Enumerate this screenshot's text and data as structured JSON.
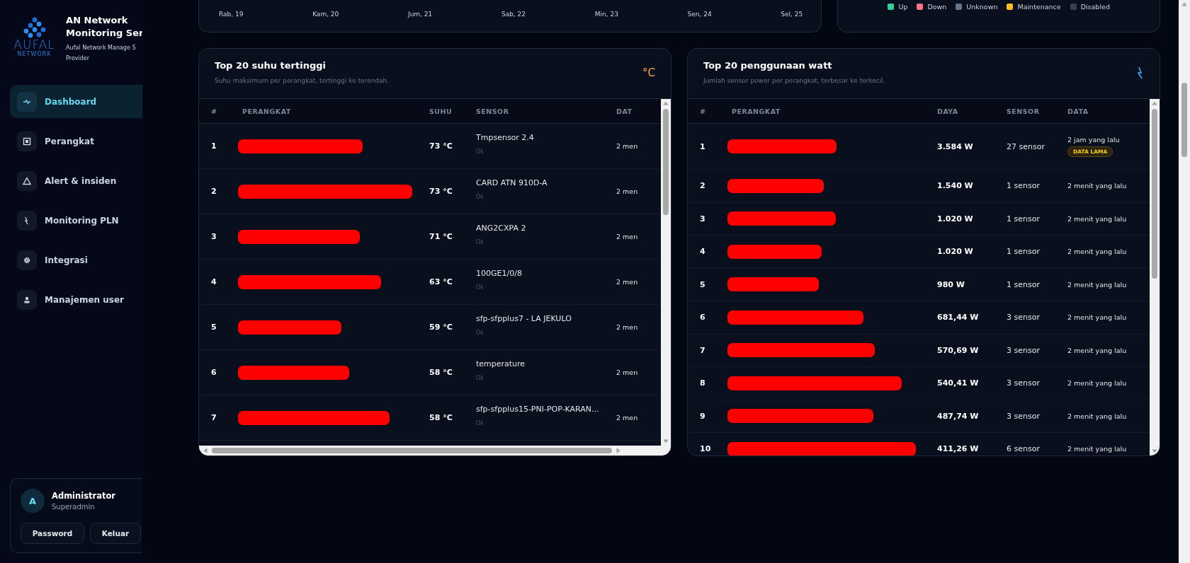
{
  "brand": {
    "logo_top": "AUFAL",
    "logo_bottom": "NETWORK",
    "title_lines": [
      "AN Network",
      "Monitoring Ser"
    ],
    "subtitle_lines": [
      "Aufal Network Manage S",
      "Provider"
    ]
  },
  "nav": [
    {
      "label": "Dashboard",
      "kind": "pulse",
      "selected": true
    },
    {
      "label": "Perangkat",
      "kind": "device",
      "selected": false
    },
    {
      "label": "Alert & insiden",
      "kind": "alert",
      "selected": false
    },
    {
      "label": "Monitoring PLN",
      "kind": "bolt",
      "selected": false
    },
    {
      "label": "Integrasi",
      "kind": "gear",
      "selected": false
    },
    {
      "label": "Manajemen user",
      "kind": "user",
      "selected": false
    }
  ],
  "user": {
    "initial": "A",
    "name": "Administrator",
    "role": "Superadmin",
    "buttons": [
      "Password",
      "Keluar"
    ]
  },
  "timeline": {
    "x_labels": [
      "Rab, 19",
      "Kam, 20",
      "Jum, 21",
      "Sab, 22",
      "Min, 23",
      "Sen, 24",
      "Sel, 25"
    ]
  },
  "legend": [
    {
      "label": "Up",
      "color": "#34d399"
    },
    {
      "label": "Down",
      "color": "#fb7185"
    },
    {
      "label": "Unknown",
      "color": "#64748b"
    },
    {
      "label": "Maintenance",
      "color": "#fbbf24"
    },
    {
      "label": "Disabled",
      "color": "#334155"
    }
  ],
  "temp_table": {
    "title": "Top 20 suhu tertinggi",
    "subtitle": "Suhu maksimum per perangkat, tertinggi ke terendah.",
    "unit_icon": "°C",
    "columns": [
      "#",
      "PERANGKAT",
      "SUHU",
      "SENSOR",
      "DAT"
    ],
    "rows": [
      {
        "rank": "1",
        "redacted": true,
        "temp": "73 °C",
        "sensor": "Tmpsensor 2.4",
        "status": "Ok",
        "data": "2 men"
      },
      {
        "rank": "2",
        "redacted": true,
        "temp": "73 °C",
        "sensor": "CARD ATN 910D-A",
        "status": "Ok",
        "data": "2 men"
      },
      {
        "rank": "3",
        "redacted": true,
        "temp": "71 °C",
        "sensor": "ANG2CXPA 2",
        "status": "Ok",
        "data": "2 men"
      },
      {
        "rank": "4",
        "redacted": true,
        "temp": "63 °C",
        "sensor": "100GE1/0/8",
        "status": "Ok",
        "data": "2 men"
      },
      {
        "rank": "5",
        "redacted": true,
        "temp": "59 °C",
        "sensor": "sfp-sfpplus7 - LA JEKULO",
        "status": "Ok",
        "data": "2 men"
      },
      {
        "rank": "6",
        "redacted": true,
        "temp": "58 °C",
        "sensor": "temperature",
        "status": "Ok",
        "data": "2 men"
      },
      {
        "rank": "7",
        "redacted": true,
        "temp": "58 °C",
        "sensor": "sfp-sfpplus15-PNI-POP-KARAN...",
        "status": "Ok",
        "data": "2 men"
      }
    ]
  },
  "watt_table": {
    "title": "Top 20 penggunaan watt",
    "subtitle": "Jumlah sensor power per perangkat, terbesar ke terkecil.",
    "columns": [
      "#",
      "PERANGKAT",
      "DAYA",
      "SENSOR",
      "DATA"
    ],
    "rows": [
      {
        "rank": "1",
        "redacted": true,
        "power": "3.584 W",
        "sensors": "27 sensor",
        "data": "2 jam yang lalu",
        "stale": true,
        "badge": "DATA LAMA"
      },
      {
        "rank": "2",
        "redacted": true,
        "power": "1.540 W",
        "sensors": "1 sensor",
        "data": "2 menit yang lalu",
        "stale": false
      },
      {
        "rank": "3",
        "redacted": true,
        "power": "1.020 W",
        "sensors": "1 sensor",
        "data": "2 menit yang lalu",
        "stale": false
      },
      {
        "rank": "4",
        "redacted": true,
        "power": "1.020 W",
        "sensors": "1 sensor",
        "data": "2 menit yang lalu",
        "stale": false
      },
      {
        "rank": "5",
        "redacted": true,
        "power": "980 W",
        "sensors": "1 sensor",
        "data": "2 menit yang lalu",
        "stale": false
      },
      {
        "rank": "6",
        "redacted": true,
        "power": "681,44 W",
        "sensors": "3 sensor",
        "data": "2 menit yang lalu",
        "stale": false
      },
      {
        "rank": "7",
        "redacted": true,
        "power": "570,69 W",
        "sensors": "3 sensor",
        "data": "2 menit yang lalu",
        "stale": false
      },
      {
        "rank": "8",
        "redacted": true,
        "power": "540,41 W",
        "sensors": "3 sensor",
        "data": "2 menit yang lalu",
        "stale": false
      },
      {
        "rank": "9",
        "redacted": true,
        "power": "487,74 W",
        "sensors": "3 sensor",
        "data": "2 menit yang lalu",
        "stale": false
      },
      {
        "rank": "10",
        "redacted": true,
        "power": "411,26 W",
        "sensors": "6 sensor",
        "data": "2 menit yang lalu",
        "stale": false
      }
    ]
  }
}
